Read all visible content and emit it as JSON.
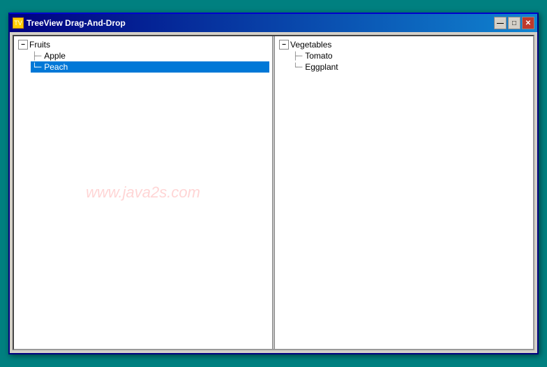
{
  "window": {
    "title": "TreeView Drag-And-Drop",
    "icon": "TV"
  },
  "titleButtons": {
    "minimize": "—",
    "maximize": "□",
    "close": "✕"
  },
  "watermark": "www.java2s.com",
  "leftPanel": {
    "rootLabel": "Fruits",
    "rootExpanded": true,
    "expandIcon": "−",
    "children": [
      {
        "label": "Apple",
        "selected": false,
        "connector": "├─"
      },
      {
        "label": "Peach",
        "selected": true,
        "connector": "└─"
      }
    ]
  },
  "rightPanel": {
    "rootLabel": "Vegetables",
    "rootExpanded": true,
    "expandIcon": "−",
    "children": [
      {
        "label": "Tomato",
        "selected": false,
        "connector": "├─"
      },
      {
        "label": "Eggplant",
        "selected": false,
        "connector": "└─"
      }
    ]
  }
}
